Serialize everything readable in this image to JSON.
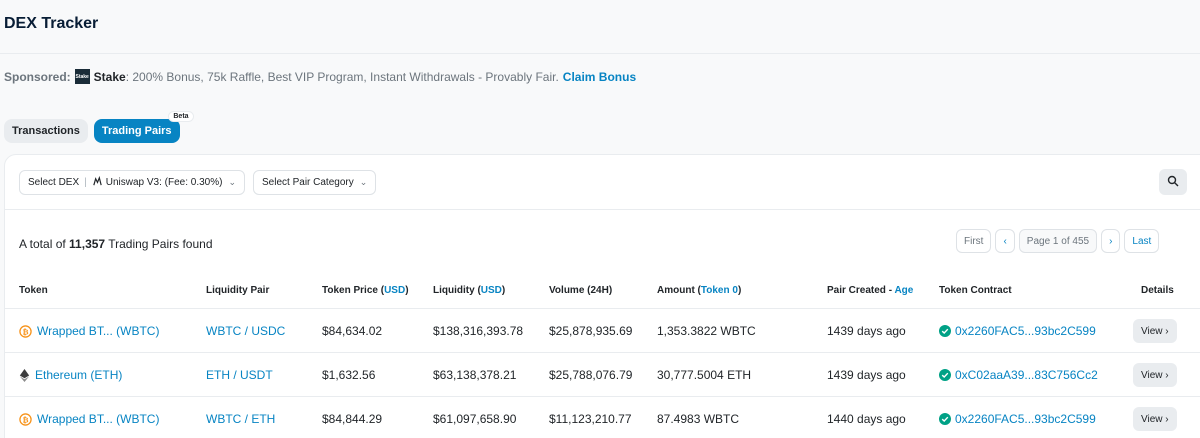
{
  "page_title": "DEX Tracker",
  "sponsor": {
    "label": "Sponsored:",
    "logo_text": "Stake",
    "name": "Stake",
    "desc": ": 200% Bonus, 75k Raffle, Best VIP Program, Instant Withdrawals - Provably Fair.",
    "cta": "Claim Bonus"
  },
  "tabs": {
    "transactions": "Transactions",
    "trading_pairs": "Trading Pairs",
    "beta": "Beta"
  },
  "filters": {
    "dex_label": "Select DEX",
    "dex_value": "Uniswap V3: (Fee: 0.30%)",
    "category_label": "Select Pair Category"
  },
  "summary": {
    "prefix": "A total of",
    "count": "11,357",
    "suffix": "Trading Pairs found"
  },
  "pager": {
    "first": "First",
    "page_info": "Page 1 of 455",
    "last": "Last"
  },
  "columns": {
    "token": "Token",
    "liquidity_pair": "Liquidity Pair",
    "token_price": "Token Price (",
    "token_price_unit": "USD",
    "liquidity": "Liquidity (",
    "liquidity_unit": "USD",
    "volume": "Volume (24H)",
    "amount": "Amount (",
    "amount_unit": "Token 0",
    "pair_created": "Pair Created - ",
    "pair_created_age": "Age",
    "token_contract": "Token Contract",
    "details": "Details"
  },
  "rows": [
    {
      "icon": "bitcoin-icon",
      "token": "Wrapped BT... (WBTC)",
      "pair": "WBTC / USDC",
      "price": "$84,634.02",
      "liquidity": "$138,316,393.78",
      "volume": "$25,878,935.69",
      "amount": "1,353.3822 WBTC",
      "created": "1439 days ago",
      "contract": "0x2260FAC5...93bc2C599",
      "view": "View"
    },
    {
      "icon": "ethereum-icon",
      "token": "Ethereum (ETH)",
      "pair": "ETH / USDT",
      "price": "$1,632.56",
      "liquidity": "$63,138,378.21",
      "volume": "$25,788,076.79",
      "amount": "30,777.5004 ETH",
      "created": "1439 days ago",
      "contract": "0xC02aaA39...83C756Cc2",
      "view": "View"
    },
    {
      "icon": "bitcoin-icon",
      "token": "Wrapped BT... (WBTC)",
      "pair": "WBTC / ETH",
      "price": "$84,844.29",
      "liquidity": "$61,097,658.90",
      "volume": "$11,123,210.77",
      "amount": "87.4983 WBTC",
      "created": "1440 days ago",
      "contract": "0x2260FAC5...93bc2C599",
      "view": "View"
    }
  ],
  "colors": {
    "accent": "#0784c3",
    "success": "#00a186"
  }
}
